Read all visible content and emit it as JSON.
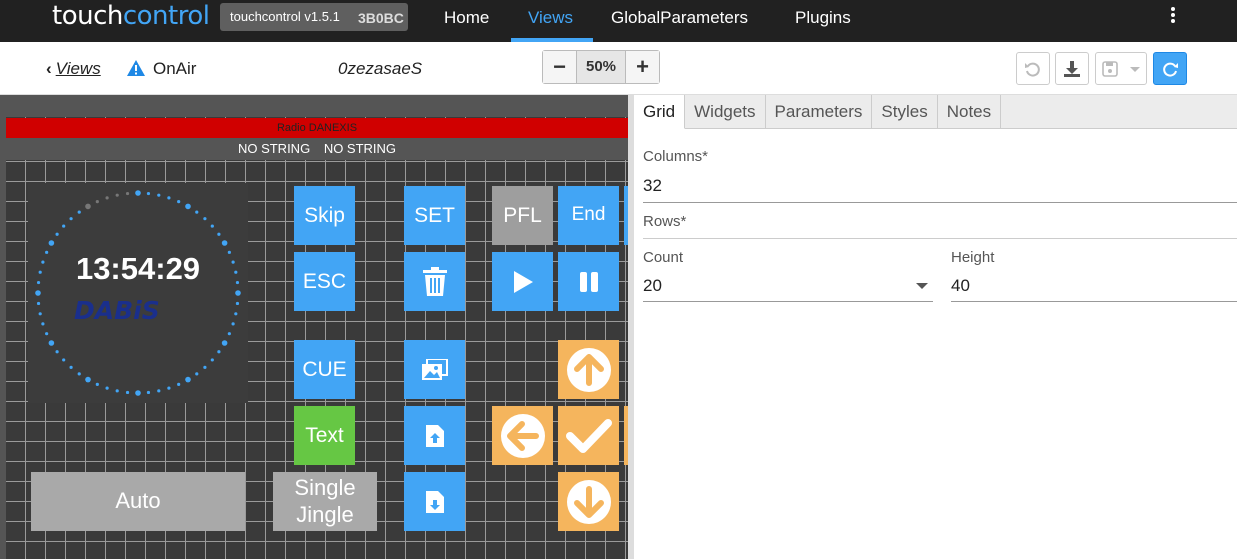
{
  "app": {
    "brand_part1": "touch",
    "brand_part2": "control",
    "version_tooltip": "touchcontrol v1.5.1",
    "tooltip_tail": "3B0BC"
  },
  "nav": {
    "home": "Home",
    "views": "Views",
    "global_parameters": "GlobalParameters",
    "plugins": "Plugins",
    "active": "Views"
  },
  "toolbar": {
    "back_label": "Views",
    "view_name": "OnAir",
    "view_id": "0zezasaeS",
    "zoom_minus": "−",
    "zoom_value": "50%",
    "zoom_plus": "+"
  },
  "canvas": {
    "radio_name": "Radio DANEXIS",
    "string1": "NO STRING",
    "string2": "NO STRING",
    "clock_time": "13:54:29",
    "logo_text": "DABiS",
    "buttons": {
      "skip": "Skip",
      "set": "SET",
      "pfl": "PFL",
      "end": "End",
      "esc": "ESC",
      "cue": "CUE",
      "text": "Text",
      "auto": "Auto",
      "single_jingle": "Single Jingle"
    }
  },
  "panel": {
    "tabs": [
      "Grid",
      "Widgets",
      "Parameters",
      "Styles",
      "Notes"
    ],
    "active_tab": "Grid",
    "columns_label": "Columns*",
    "columns_value": "32",
    "rows_label": "Rows*",
    "count_label": "Count",
    "count_value": "20",
    "height_label": "Height",
    "height_value": "40"
  },
  "colors": {
    "accent": "#42a5f5",
    "nav_bg": "#212121",
    "widget_blue": "#42a5f5",
    "widget_orange": "#f5b55d",
    "widget_green": "#66c744",
    "widget_grey": "#9e9e9e",
    "radio_bar_red": "#d00000",
    "warning": "#1e88e5"
  }
}
